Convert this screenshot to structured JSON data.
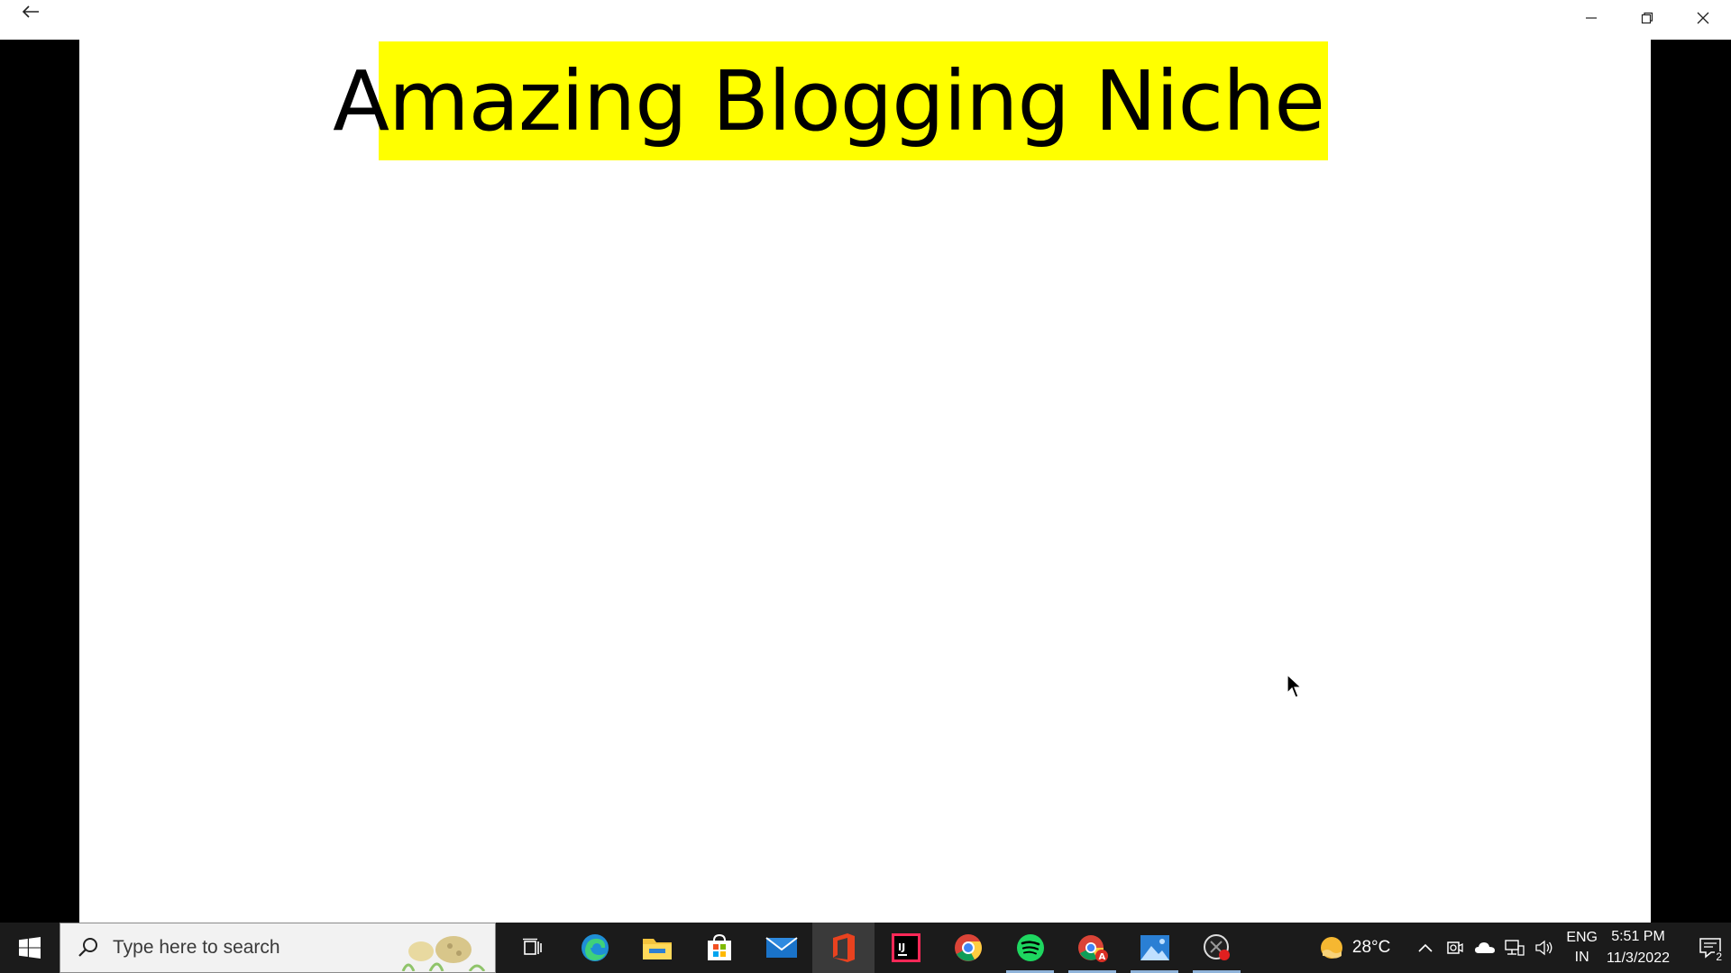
{
  "slide": {
    "title": "Amazing Blogging Niche",
    "title_bg": "#ffff00"
  },
  "window_controls": [
    "minimize-icon",
    "restore-icon",
    "close-icon"
  ],
  "taskbar": {
    "search_placeholder": "Type here to search",
    "pinned": [
      {
        "name": "task-view",
        "icon": "task-view-icon"
      },
      {
        "name": "edge",
        "icon": "edge-icon"
      },
      {
        "name": "file-explorer",
        "icon": "folder-icon"
      },
      {
        "name": "microsoft-store",
        "icon": "store-icon"
      },
      {
        "name": "mail",
        "icon": "mail-icon"
      },
      {
        "name": "office",
        "icon": "office-icon",
        "active": true
      },
      {
        "name": "intellij",
        "icon": "intellij-icon"
      },
      {
        "name": "chrome",
        "icon": "chrome-icon"
      },
      {
        "name": "spotify",
        "icon": "spotify-icon",
        "running": true
      },
      {
        "name": "chrome-profile",
        "icon": "chrome-profile-icon",
        "running": true
      },
      {
        "name": "photos",
        "icon": "photos-icon",
        "running": true
      },
      {
        "name": "screen-recorder",
        "icon": "recorder-icon",
        "running": true
      }
    ],
    "weather": "28°C",
    "lang_top": "ENG",
    "lang_bottom": "IN",
    "time": "5:51 PM",
    "date": "11/3/2022",
    "notification_count": "2"
  }
}
